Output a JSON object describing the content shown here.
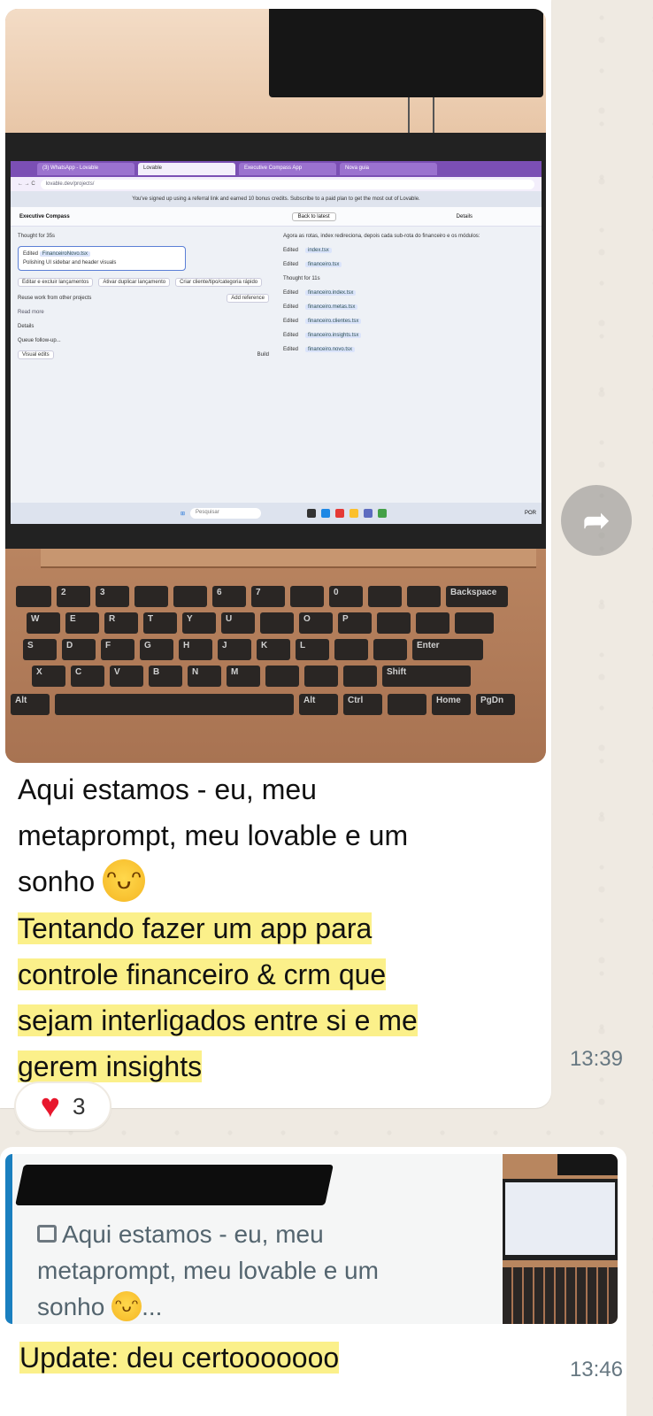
{
  "photo": {
    "tabs": [
      "(3) WhatsApp - Lovable",
      "Lovable",
      "Executive Compass App",
      "Nova guia"
    ],
    "url": "lovable.dev/projects/",
    "banner": "You've signed up using a referral link and earned 10 bonus credits. Subscribe to a paid plan to get the most out of Lovable.",
    "project_name": "Executive Compass",
    "back_button": "Back to latest",
    "details": "Details",
    "taskbar_search": "Pesquisar",
    "taskbar_lang": "POR",
    "left": {
      "thought": "Thought for 35s",
      "edited": "Edited",
      "file": "FinanceiroNovo.tsx",
      "polishing": "Polishing UI sidebar and header visuals",
      "suggestions": [
        "Editar e excluir lançamentos",
        "Ativar duplicar lançamento",
        "Criar cliente/tipo/categoria rápido"
      ],
      "reuse": "Reuse work from other projects",
      "add_reference": "Add reference",
      "read_more": "Read more",
      "details": "Details",
      "queue": "Queue follow-up...",
      "visual_edits": "Visual edits",
      "build": "Build"
    },
    "right": {
      "intro": "Agora as rotas, index redireciona, depois cada sub-rota do financeiro e os módulos:",
      "thought": "Thought for 11s",
      "lines": [
        {
          "label": "Edited",
          "file": "index.tsx"
        },
        {
          "label": "Edited",
          "file": "financeiro.tsx"
        },
        {
          "label": "Edited",
          "file": "financeiro.index.tsx"
        },
        {
          "label": "Edited",
          "file": "financeiro.metas.tsx"
        },
        {
          "label": "Edited",
          "file": "financeiro.clientes.tsx"
        },
        {
          "label": "Edited",
          "file": "financeiro.insights.tsx"
        },
        {
          "label": "Edited",
          "file": "financeiro.novo.tsx"
        }
      ]
    },
    "keys": {
      "r1": [
        "2",
        "3",
        "6",
        "7",
        "0"
      ],
      "r2": [
        "W",
        "E",
        "R",
        "T",
        "Y",
        "U",
        "O",
        "P"
      ],
      "r3": [
        "S",
        "D",
        "F",
        "G",
        "H",
        "J",
        "K",
        "L"
      ],
      "r4": [
        "X",
        "C",
        "V",
        "B",
        "N",
        "M"
      ],
      "backspace": "Backspace",
      "enter": "Enter",
      "shift": "Shift",
      "alt": "Alt",
      "alt2": "Alt",
      "ctrl": "Ctrl",
      "home": "Home",
      "pgdn": "PgDn"
    }
  },
  "message1": {
    "line1": "Aqui estamos - eu, meu",
    "line2": "metaprompt, meu lovable e um",
    "line3": "sonho",
    "line4": "Tentando fazer um app para",
    "line5": "controle financeiro & crm que",
    "line6": "sejam interligados entre si e me",
    "line7": "gerem insights",
    "time": "13:39",
    "reaction_count": "3"
  },
  "message2": {
    "quote": {
      "line1": "Aqui estamos - eu, meu",
      "line2": "metaprompt, meu lovable e um",
      "line3": "sonho",
      "ellipsis": "..."
    },
    "text": "Update: deu certooooooo",
    "time": "13:46"
  },
  "colors": {
    "chat_background": "#efeae2",
    "bubble": "#ffffff",
    "highlight": "#fbf08a",
    "quote_bar": "#1a7fbf",
    "timestamp": "#667781",
    "heart": "#e8172d"
  }
}
